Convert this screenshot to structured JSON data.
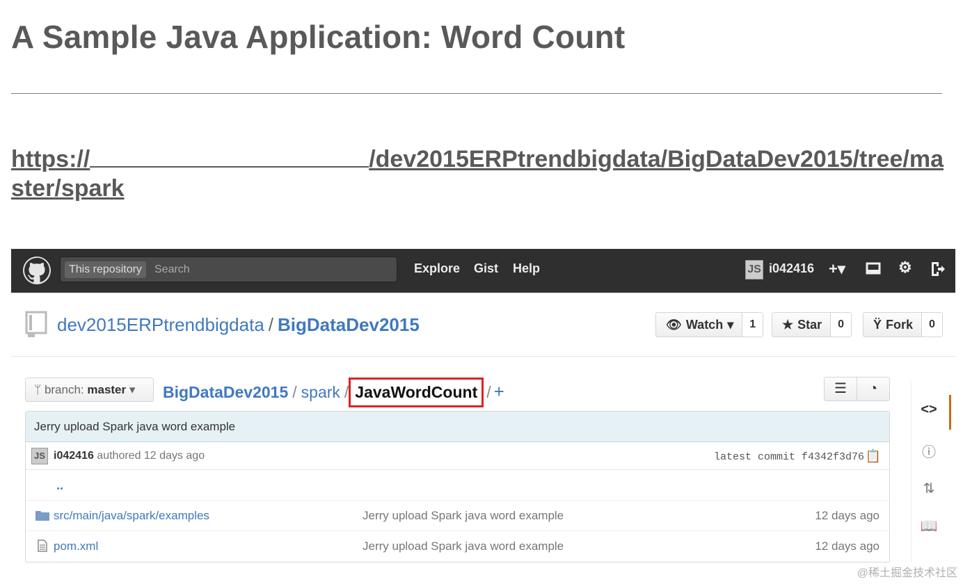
{
  "slide": {
    "title": "A Sample Java Application: Word Count",
    "link_start": "https://",
    "link_end": "/dev2015ERPtrendbigdata/BigDataDev2015/tree/ma",
    "link_line2": "ster/spark"
  },
  "header": {
    "search_scope": "This repository",
    "search_placeholder": "Search",
    "nav": [
      "Explore",
      "Gist",
      "Help"
    ],
    "avatar_initials": "JS",
    "username": "i042416",
    "plus_icon": "+▾"
  },
  "repo": {
    "owner": "dev2015ERPtrendbigdata",
    "separator": "/",
    "name": "BigDataDev2015",
    "watch_label": "Watch",
    "watch_count": "1",
    "star_label": "Star",
    "star_count": "0",
    "fork_label": "Fork",
    "fork_count": "0"
  },
  "branch": {
    "prefix": "branch:",
    "name": "master"
  },
  "breadcrumb": {
    "root": "BigDataDev2015",
    "sep": "/",
    "folder": "spark",
    "current": "JavaWordCount",
    "trailing_sep": "/",
    "plus": "+"
  },
  "commit": {
    "message": "Jerry upload Spark java word example",
    "avatar_initials": "JS",
    "author": "i042416",
    "authored_text": "authored 12 days ago",
    "latest_label": "latest commit",
    "sha": "f4342f3d76"
  },
  "files": {
    "up_dir": "..",
    "rows": [
      {
        "path_prefix": "src/main/java/spark/",
        "name": "examples",
        "message": "Jerry upload Spark java word example",
        "age": "12 days ago"
      },
      {
        "path_prefix": "",
        "name": "pom.xml",
        "message": "Jerry upload Spark java word example",
        "age": "12 days ago"
      }
    ]
  },
  "watermark": "@稀土掘金技术社区"
}
